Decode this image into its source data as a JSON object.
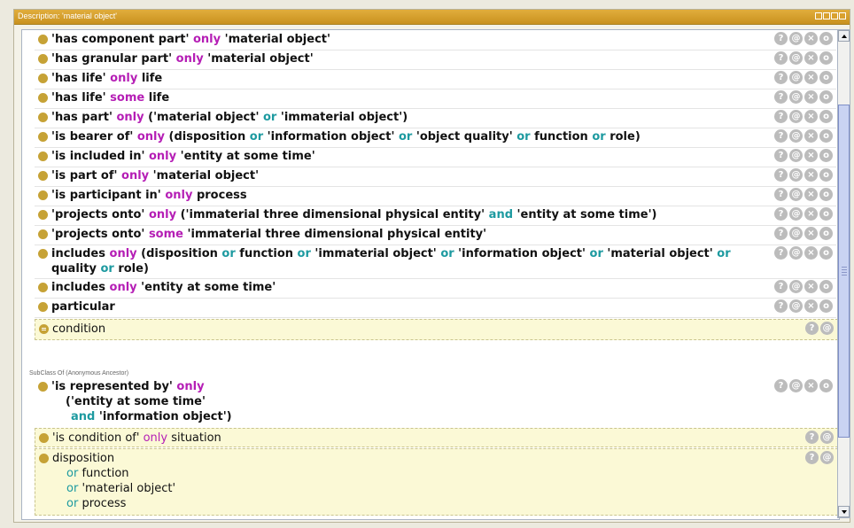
{
  "window": {
    "title": "Description: 'material object'"
  },
  "icons": {
    "help": "?",
    "annotate": "@",
    "delete": "×",
    "edit": "o"
  },
  "rows": [
    {
      "a": "'has component part' ",
      "k": "only",
      "b": " 'material object'"
    },
    {
      "a": "'has granular part' ",
      "k": "only",
      "b": " 'material object'"
    },
    {
      "a": "'has life' ",
      "k": "only",
      "b": " life"
    },
    {
      "a": "'has life' ",
      "k": "some",
      "b": " life"
    },
    {
      "a": "'has part' ",
      "k": "only",
      "b": " ('material object' ",
      "k2": "or",
      "c": " 'immaterial object')"
    },
    {
      "a": "'is bearer of' ",
      "k": "only",
      "b": " (disposition ",
      "k2": "or",
      "c": " 'information object' ",
      "k3": "or",
      "d": " 'object quality' ",
      "k4": "or",
      "e": " function ",
      "k5": "or",
      "f": " role)"
    },
    {
      "a": "'is included in' ",
      "k": "only",
      "b": " 'entity at some time'"
    },
    {
      "a": "'is part of' ",
      "k": "only",
      "b": " 'material object'"
    },
    {
      "a": "'is participant in' ",
      "k": "only",
      "b": " process"
    },
    {
      "a": "'projects onto' ",
      "k": "only",
      "b": " ('immaterial three dimensional physical entity' ",
      "k2": "and",
      "c": " 'entity at some time')"
    },
    {
      "a": "'projects onto' ",
      "k": "some",
      "b": " 'immaterial three dimensional physical entity'"
    },
    {
      "a": "includes ",
      "k": "only",
      "b": " (disposition ",
      "k2": "or",
      "c": " function ",
      "k3": "or",
      "d": " 'immaterial object' ",
      "k4": "or",
      "e": " 'information object' ",
      "k5": "or",
      "f": " 'material object' ",
      "k6": "or",
      "g": " quality ",
      "k7": "or",
      "h": " role)"
    },
    {
      "a": "includes ",
      "k": "only",
      "b": " 'entity at some time'"
    },
    {
      "a": "particular"
    }
  ],
  "condition": {
    "label": "condition"
  },
  "section": {
    "label": "SubClass Of (Anonymous Ancestor)"
  },
  "ancestor": {
    "line1a": "'is represented by' ",
    "line1k": "only",
    "line2": "('entity at some time'",
    "line3k": "and",
    "line3b": " 'information object')"
  },
  "cond_of": {
    "a": "'is condition of' ",
    "k": "only",
    "b": " situation"
  },
  "disp": {
    "l1": "disposition",
    "l2k": "or",
    "l2": " function",
    "l3k": "or",
    "l3": " 'material object'",
    "l4k": "or",
    "l4": " process"
  }
}
